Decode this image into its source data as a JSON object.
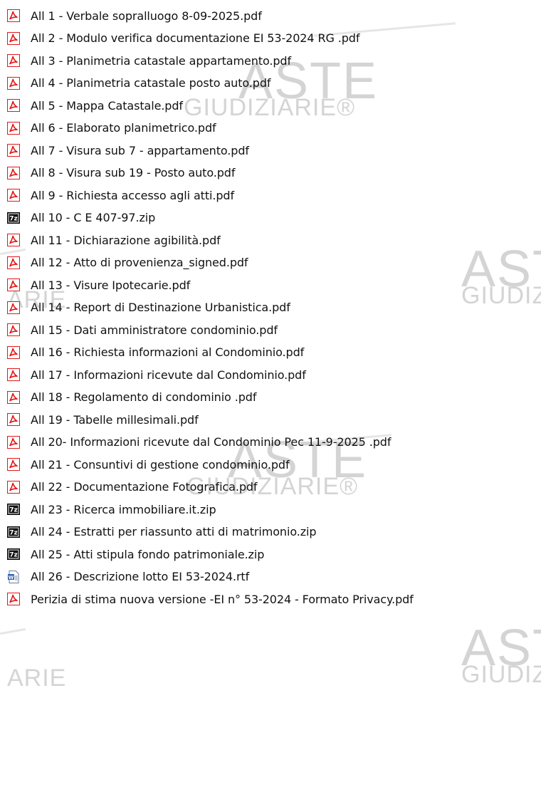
{
  "watermark": {
    "brand": "ASTE",
    "sub": "GIUDIZIARIE",
    "fragments": [
      "ASTE",
      "GIUDIZIARIE®",
      "ASTE",
      "GIUDIZIARIE®",
      "ASTE",
      "GIUDIZIARIE®",
      "ASTE",
      "GIUDIZIARIE®",
      "ARIE",
      "ARIE"
    ]
  },
  "icon_types": {
    "pdf": {
      "icon": "pdf-icon",
      "color": "#e11919"
    },
    "zip": {
      "icon": "7z-archive-icon",
      "color": "#000000"
    },
    "rtf": {
      "icon": "word-document-icon",
      "color": "#2b5fb4"
    }
  },
  "files": [
    {
      "name": "All 1 - Verbale sopralluogo  8-09-2025.pdf",
      "type": "pdf"
    },
    {
      "name": "All 2 - Modulo verifica documentazione EI 53-2024 RG .pdf",
      "type": "pdf"
    },
    {
      "name": "All 3 - Planimetria catastale appartamento.pdf",
      "type": "pdf"
    },
    {
      "name": "All 4 - Planimetria catastale posto auto.pdf",
      "type": "pdf"
    },
    {
      "name": "All 5 - Mappa Catastale.pdf",
      "type": "pdf"
    },
    {
      "name": "All 6 - Elaborato planimetrico.pdf",
      "type": "pdf"
    },
    {
      "name": "All 7 - Visura sub 7 - appartamento.pdf",
      "type": "pdf"
    },
    {
      "name": "All 8 - Visura sub 19  - Posto auto.pdf",
      "type": "pdf"
    },
    {
      "name": "All 9 - Richiesta accesso agli atti.pdf",
      "type": "pdf"
    },
    {
      "name": "All 10 - C E 407-97.zip",
      "type": "zip"
    },
    {
      "name": "All 11 - Dichiarazione agibilità.pdf",
      "type": "pdf"
    },
    {
      "name": "All 12 - Atto di provenienza_signed.pdf",
      "type": "pdf"
    },
    {
      "name": "All 13 - Visure Ipotecarie.pdf",
      "type": "pdf"
    },
    {
      "name": "All 14 - Report di Destinazione Urbanistica.pdf",
      "type": "pdf"
    },
    {
      "name": "All 15 - Dati amministratore condominio.pdf",
      "type": "pdf"
    },
    {
      "name": "All 16 - Richiesta informazioni al Condominio.pdf",
      "type": "pdf"
    },
    {
      "name": "All 17 - Informazioni ricevute dal Condominio.pdf",
      "type": "pdf"
    },
    {
      "name": "All 18 - Regolamento di condominio .pdf",
      "type": "pdf"
    },
    {
      "name": "All 19 - Tabelle millesimali.pdf",
      "type": "pdf"
    },
    {
      "name": "All 20- Informazioni ricevute dal Condominio Pec 11-9-2025 .pdf",
      "type": "pdf"
    },
    {
      "name": "All 21 - Consuntivi di gestione condominio.pdf",
      "type": "pdf"
    },
    {
      "name": "All 22 - Documentazione Fotografica.pdf",
      "type": "pdf"
    },
    {
      "name": "All 23 - Ricerca immobiliare.it.zip",
      "type": "zip"
    },
    {
      "name": "All 24 - Estratti per riassunto atti di matrimonio.zip",
      "type": "zip"
    },
    {
      "name": "All 25 - Atti stipula fondo patrimoniale.zip",
      "type": "zip"
    },
    {
      "name": "All 26 - Descrizione lotto EI 53-2024.rtf",
      "type": "rtf"
    },
    {
      "name": "Perizia di stima nuova versione -EI n° 53-2024 - Formato Privacy.pdf",
      "type": "pdf"
    }
  ]
}
